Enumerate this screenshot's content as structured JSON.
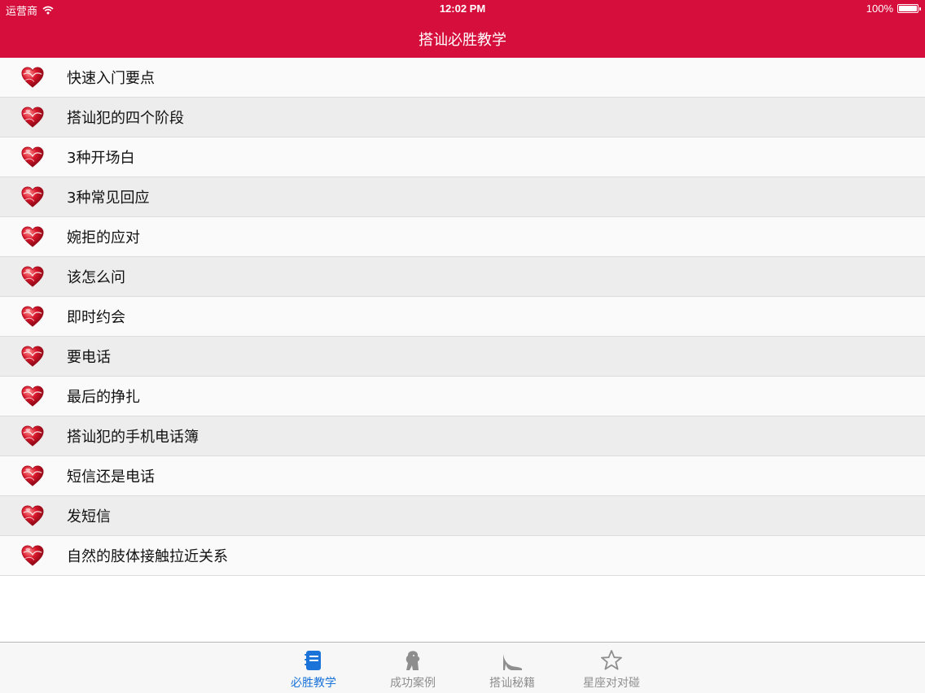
{
  "status_bar": {
    "carrier": "运营商",
    "time": "12:02 PM",
    "battery": "100%",
    "battery_level": 1.0
  },
  "nav": {
    "title": "搭讪必胜教学"
  },
  "list": {
    "items": [
      {
        "label": "快速入门要点"
      },
      {
        "label": "搭讪犯的四个阶段"
      },
      {
        "label": "3种开场白"
      },
      {
        "label": "3种常见回应"
      },
      {
        "label": "婉拒的应对"
      },
      {
        "label": "该怎么问"
      },
      {
        "label": "即时约会"
      },
      {
        "label": "要电话"
      },
      {
        "label": "最后的挣扎"
      },
      {
        "label": "搭讪犯的手机电话簿"
      },
      {
        "label": "短信还是电话"
      },
      {
        "label": "发短信"
      },
      {
        "label": "自然的肢体接触拉近关系"
      }
    ],
    "item_icon": "heart-icon"
  },
  "tabbar": {
    "tabs": [
      {
        "label": "必胜教学",
        "icon": "notebook-icon",
        "active": true
      },
      {
        "label": "成功案例",
        "icon": "lion-icon",
        "active": false
      },
      {
        "label": "搭讪秘籍",
        "icon": "high-heel-icon",
        "active": false
      },
      {
        "label": "星座对对碰",
        "icon": "star-icon",
        "active": false
      }
    ]
  },
  "colors": {
    "header": "#d50e3c",
    "active_tab": "#1a73d9",
    "inactive_tab": "#8e8e8e"
  }
}
